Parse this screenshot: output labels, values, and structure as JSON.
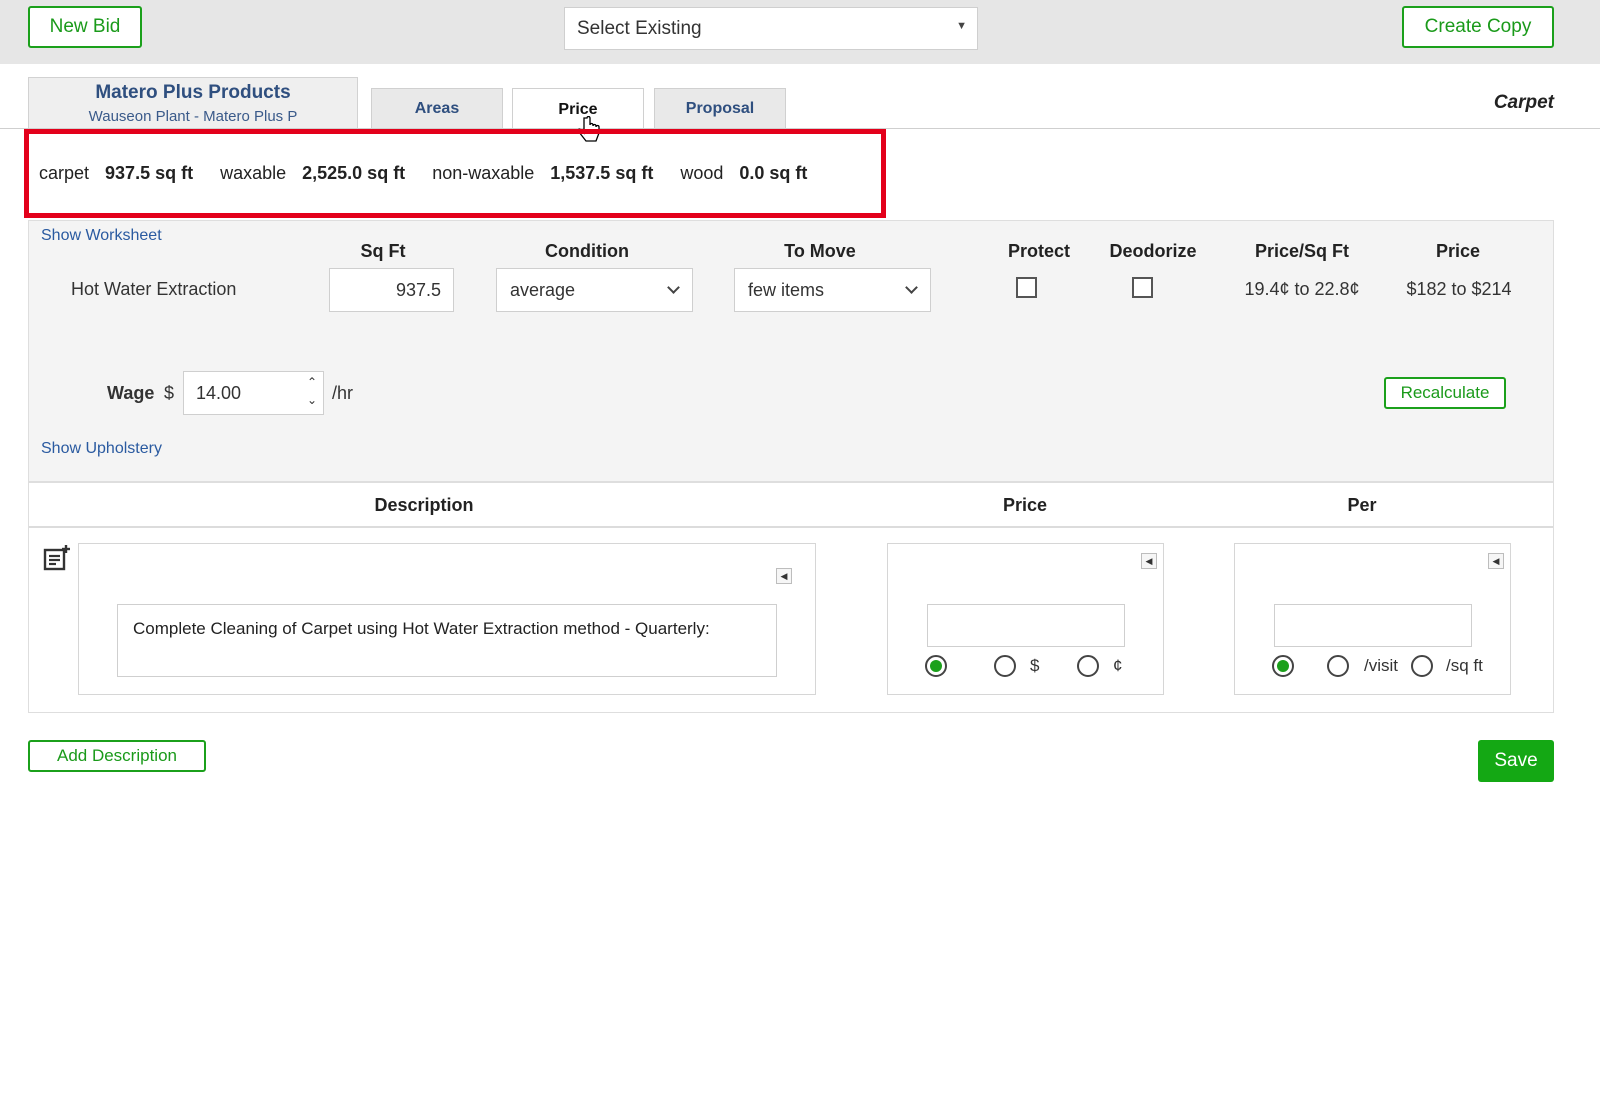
{
  "toolbar": {
    "new_bid": "New Bid",
    "select_existing": "Select Existing",
    "create_copy": "Create Copy"
  },
  "header": {
    "company_name": "Matero Plus Products",
    "company_sub": "Wauseon Plant - Matero Plus P",
    "tabs": [
      {
        "label": "Areas",
        "active": false
      },
      {
        "label": "Price",
        "active": true
      },
      {
        "label": "Proposal",
        "active": false
      }
    ],
    "category": "Carpet"
  },
  "summary": [
    {
      "label": "carpet",
      "value": "937.5 sq ft"
    },
    {
      "label": "waxable",
      "value": "2,525.0 sq ft"
    },
    {
      "label": "non-waxable",
      "value": "1,537.5 sq ft"
    },
    {
      "label": "wood",
      "value": "0.0 sq ft"
    }
  ],
  "worksheet": {
    "show_worksheet": "Show Worksheet",
    "columns": {
      "sqft": "Sq Ft",
      "condition": "Condition",
      "to_move": "To Move",
      "protect": "Protect",
      "deodorize": "Deodorize",
      "price_per_sqft": "Price/Sq Ft",
      "price": "Price"
    },
    "row": {
      "service": "Hot Water Extraction",
      "sqft": "937.5",
      "condition": "average",
      "to_move": "few items",
      "protect": false,
      "deodorize": false,
      "price_per_sqft": "19.4¢ to 22.8¢",
      "price": "$182 to $214"
    },
    "wage_label": "Wage",
    "wage_currency": "$",
    "wage_value": "14.00",
    "wage_unit": "/hr",
    "recalculate": "Recalculate",
    "show_upholstery": "Show Upholstery"
  },
  "descriptions": {
    "columns": {
      "description": "Description",
      "price": "Price",
      "per": "Per"
    },
    "items": [
      {
        "text": "Complete Cleaning of Carpet using Hot Water Extraction method - Quarterly:",
        "price_value": "",
        "price_options": [
          "",
          "$",
          "¢"
        ],
        "price_selected": 0,
        "per_value": "",
        "per_options": [
          "",
          "/visit",
          "/sq ft"
        ],
        "per_selected": 0
      }
    ]
  },
  "footer": {
    "add_description": "Add Description",
    "save": "Save"
  },
  "colors": {
    "accent_green": "#1ba01b",
    "highlight_red": "#e3001b",
    "link_blue": "#2a5aa0"
  },
  "icons": [
    "dropdown-caret-icon",
    "chevron-down-icon",
    "spinner-up-icon",
    "spinner-down-icon",
    "add-note-icon",
    "collapse-arrow-icon"
  ]
}
